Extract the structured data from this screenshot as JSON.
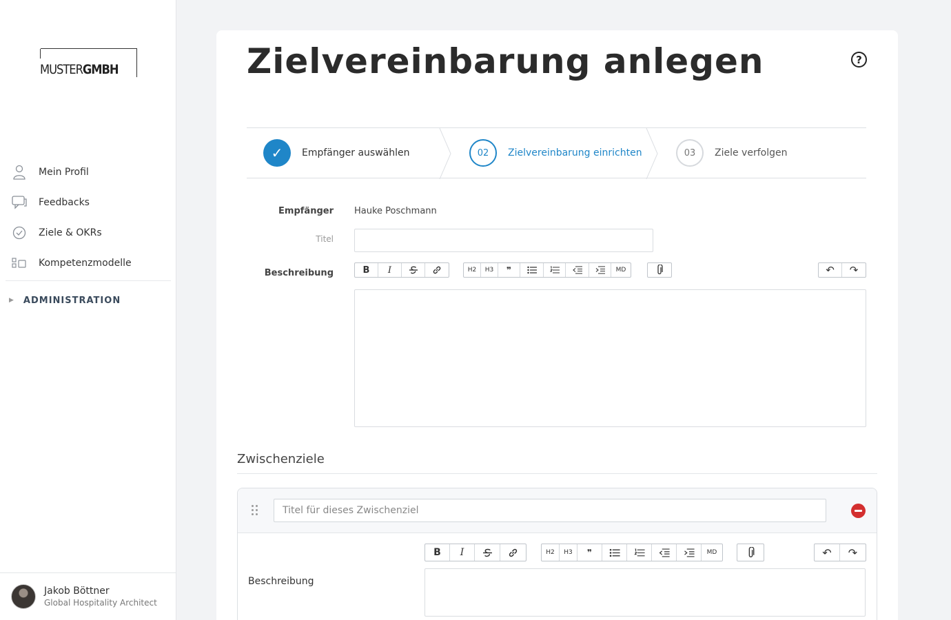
{
  "brand": {
    "logo_light": "MUSTER",
    "logo_bold": "GMBH"
  },
  "sidebar": {
    "items": [
      {
        "label": "Mein Profil",
        "icon": "user-icon"
      },
      {
        "label": "Feedbacks",
        "icon": "chat-icon"
      },
      {
        "label": "Ziele & OKRs",
        "icon": "check-circle-icon"
      },
      {
        "label": "Kompetenzmodelle",
        "icon": "grid-icon"
      }
    ],
    "admin_label": "ADMINISTRATION"
  },
  "user": {
    "name": "Jakob Böttner",
    "role": "Global Hospitality Architect"
  },
  "page": {
    "title": "Zielvereinbarung anlegen",
    "help": "?"
  },
  "steps": [
    {
      "num": "✓",
      "label": "Empfänger auswählen",
      "state": "done"
    },
    {
      "num": "02",
      "label": "Zielvereinbarung einrichten",
      "state": "active"
    },
    {
      "num": "03",
      "label": "Ziele verfolgen",
      "state": "todo"
    }
  ],
  "form": {
    "recipient_label": "Empfänger",
    "recipient_value": "Hauke Poschmann",
    "title_label": "Titel",
    "title_value": "",
    "description_label": "Beschreibung"
  },
  "toolbar": {
    "bold": "B",
    "italic": "I",
    "h2": "H2",
    "h3": "H3",
    "quote": "❞",
    "md": "MD",
    "undo": "↶",
    "redo": "↷"
  },
  "milestones": {
    "section_title": "Zwischenziele",
    "title_placeholder": "Titel für dieses Zwischenziel",
    "description_label": "Beschreibung"
  },
  "colors": {
    "accent": "#1f86c8",
    "danger": "#d32f2f"
  }
}
